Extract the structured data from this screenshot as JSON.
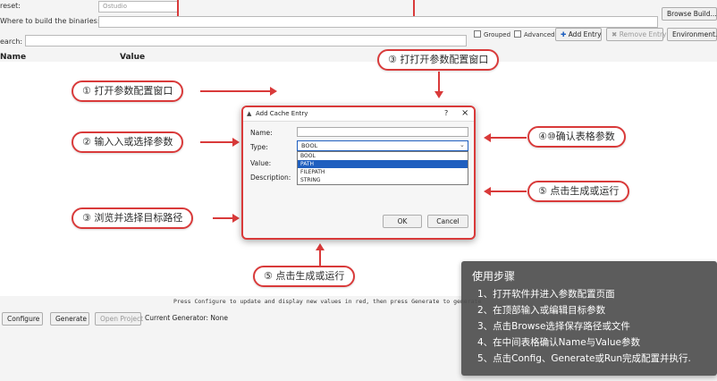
{
  "toolbar": {
    "preset_label": "reset:",
    "preset_value": "Ostudio",
    "build_label": "Where to build the binaries:",
    "browse_build": "Browse Build...",
    "search_label": "earch:",
    "grouped": "Grouped",
    "advanced": "Advanced",
    "add_entry": "Add Entry",
    "remove_entry": "Remove Entry",
    "environment": "Environment..."
  },
  "table": {
    "col_name": "Name",
    "col_value": "Value"
  },
  "dialog": {
    "title": "Add Cache Entry",
    "help": "?",
    "close": "×",
    "name_label": "Name:",
    "type_label": "Type:",
    "value_label": "Value:",
    "description_label": "Description:",
    "type_selected": "BOOL",
    "type_options": [
      "BOOL",
      "PATH",
      "FILEPATH",
      "STRING"
    ],
    "ok": "OK",
    "cancel": "Cancel"
  },
  "callouts": {
    "c1": "① 打开参数配置窗口",
    "c2": "② 输入入或选择参数",
    "c3_left": "③ 浏览并选择目标路径",
    "c3_top": "③ 打打开参数配置窗口",
    "c4": "④⑩确认表格参数",
    "c5_right": "⑤ 点击生成或运行",
    "c5_bottom": "⑤ 点击生成或运行"
  },
  "status": {
    "message": "Press Configure to update and display new values in red, then press Generate to generate"
  },
  "bottom": {
    "configure": "Configure",
    "generate": "Generate",
    "open_project": "Open Project",
    "current_generator": "Current Generator: None"
  },
  "steps": {
    "title": "使用步骤",
    "items": [
      "1、打开软件并进入参数配置页面",
      "2、在顶部输入或编辑目标参数",
      "3、点击Browse选择保存路径或文件",
      "4、在中间表格确认Name与Value参数",
      "5、点击Config、Generate或Run完成配置并执行."
    ]
  },
  "colors": {
    "accent_red": "#d93a3a",
    "panel": "#505050",
    "selection": "#1f5fbf"
  }
}
